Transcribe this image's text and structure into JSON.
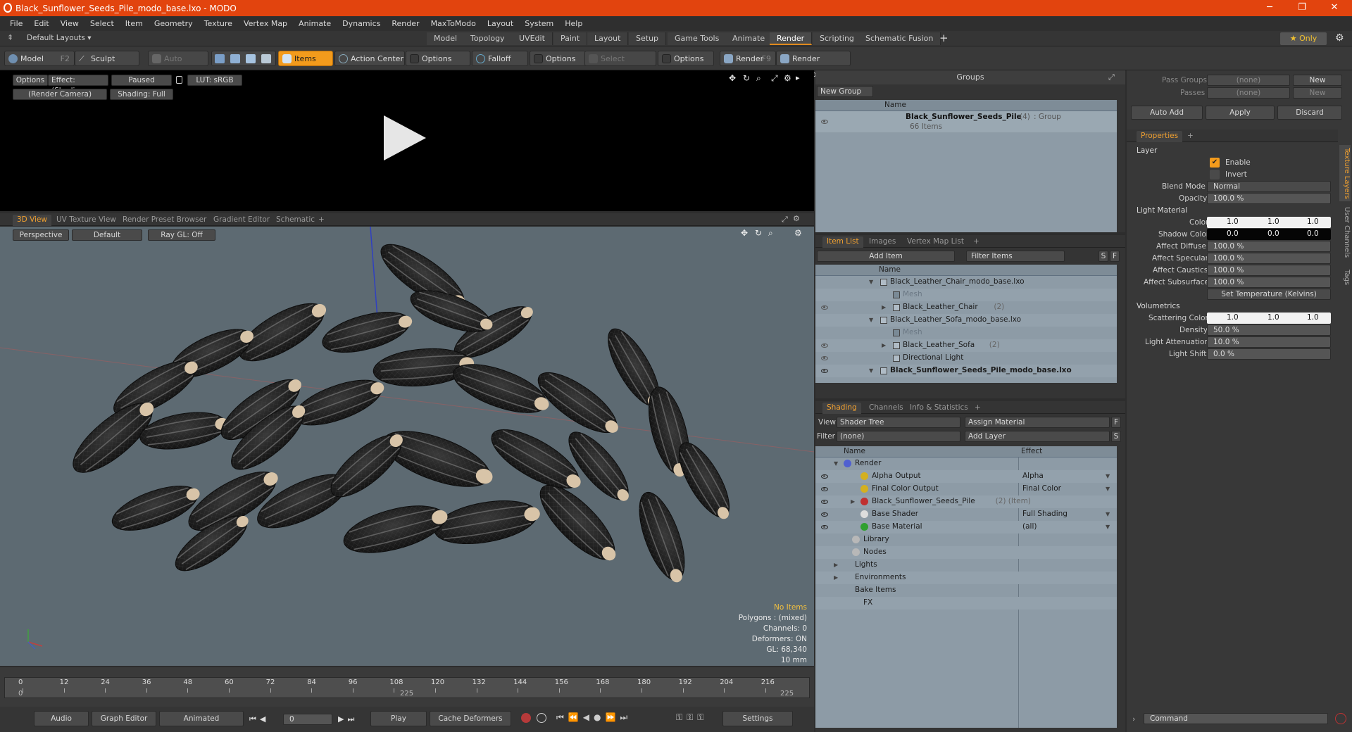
{
  "titlebar": {
    "title": "Black_Sunflower_Seeds_Pile_modo_base.lxo - MODO",
    "min": "─",
    "max": "❐",
    "close": "✕"
  },
  "menu": [
    "File",
    "Edit",
    "View",
    "Select",
    "Item",
    "Geometry",
    "Texture",
    "Vertex Map",
    "Animate",
    "Dynamics",
    "Render",
    "MaxToModo",
    "Layout",
    "System",
    "Help"
  ],
  "layoutbar": {
    "default_layouts": "Default Layouts ▾",
    "tabs": [
      "Model",
      "Topology",
      "UVEdit",
      "Paint",
      "Layout",
      "Setup",
      "Game Tools",
      "Animate",
      "Render",
      "Scripting",
      "Schematic Fusion"
    ],
    "active": "Render",
    "plus": "+",
    "only": "★  Only",
    "gear": "⚙"
  },
  "toolbar": {
    "model": "Model",
    "model_key": "F2",
    "sculpt": "Sculpt",
    "auto_select": "Auto Select",
    "items": "Items",
    "action_center": "Action Center",
    "options1": "Options",
    "falloff": "Falloff",
    "options2": "Options",
    "select_through": "Select Through",
    "options3": "Options",
    "render": "Render",
    "render_key": "F9",
    "render_window": "Render Window"
  },
  "render_view": {
    "options": "Options",
    "effect": "Effect: (Shadi...",
    "paused": "Paused",
    "lut": "LUT: sRGB",
    "camera": "(Render Camera)",
    "shading": "Shading: Full"
  },
  "viewport": {
    "tabs": [
      "3D View",
      "UV Texture View",
      "Render Preset Browser",
      "Gradient Editor",
      "Schematic"
    ],
    "plus": "+",
    "perspective": "Perspective",
    "default": "Default",
    "raygl": "Ray GL: Off",
    "stats": {
      "no_items": "No Items",
      "polygons": "Polygons : (mixed)",
      "channels": "Channels: 0",
      "deformers": "Deformers: ON",
      "gl": "GL: 68,340",
      "scale": "10 mm"
    }
  },
  "timeline": {
    "ticks": [
      "0",
      "12",
      "24",
      "36",
      "48",
      "60",
      "72",
      "84",
      "96",
      "108",
      "120",
      "132",
      "144",
      "156",
      "168",
      "180",
      "192",
      "204",
      "216"
    ],
    "start": "0",
    "mid": "225",
    "end": "225"
  },
  "bottombar": {
    "audio": "Audio",
    "graph_editor": "Graph Editor",
    "animated": "Animated",
    "frame": "0",
    "play": "Play",
    "cache_deformers": "Cache Deformers",
    "settings": "Settings"
  },
  "groups": {
    "title": "Groups",
    "new_group": "New Group",
    "col_name": "Name",
    "group_name": "Black_Sunflower_Seeds_Pile",
    "group_count": "(4)",
    "group_type": ": Group",
    "group_items": "66 Items"
  },
  "itemlist": {
    "tabs": [
      "Item List",
      "Images",
      "Vertex Map List"
    ],
    "plus": "+",
    "add_item": "Add Item",
    "filter_items": "Filter Items",
    "s": "S",
    "f": "F",
    "col_name": "Name",
    "rows": [
      {
        "label": "Black_Leather_Chair_modo_base.lxo",
        "dim": false,
        "count": ""
      },
      {
        "label": "Mesh",
        "dim": true,
        "count": ""
      },
      {
        "label": "Black_Leather_Chair",
        "dim": false,
        "count": "(2)"
      },
      {
        "label": "Black_Leather_Sofa_modo_base.lxo",
        "dim": false,
        "count": ""
      },
      {
        "label": "Mesh",
        "dim": true,
        "count": ""
      },
      {
        "label": "Black_Leather_Sofa",
        "dim": false,
        "count": "(2)"
      },
      {
        "label": "Directional Light",
        "dim": false,
        "count": ""
      },
      {
        "label": "Black_Sunflower_Seeds_Pile_modo_base.lxo",
        "dim": false,
        "count": ""
      }
    ]
  },
  "shading": {
    "tabs": [
      "Shading",
      "Channels",
      "Info & Statistics"
    ],
    "plus": "+",
    "view_label": "View",
    "view_value": "Shader Tree",
    "assign_material": "Assign Material",
    "f": "F",
    "filter_label": "Filter",
    "filter_value": "(none)",
    "add_layer": "Add Layer",
    "s": "S",
    "col_name": "Name",
    "col_effect": "Effect",
    "rows": [
      {
        "label": "Render",
        "effect": "",
        "extra": ""
      },
      {
        "label": "Alpha Output",
        "effect": "Alpha",
        "extra": ""
      },
      {
        "label": "Final Color Output",
        "effect": "Final Color",
        "extra": ""
      },
      {
        "label": "Black_Sunflower_Seeds_Pile",
        "effect": "",
        "extra": "(2) (Item)"
      },
      {
        "label": "Base Shader",
        "effect": "Full Shading",
        "extra": ""
      },
      {
        "label": "Base Material",
        "effect": "(all)",
        "extra": ""
      },
      {
        "label": "Library",
        "effect": "",
        "extra": ""
      },
      {
        "label": "Nodes",
        "effect": "",
        "extra": ""
      },
      {
        "label": "Lights",
        "effect": "",
        "extra": ""
      },
      {
        "label": "Environments",
        "effect": "",
        "extra": ""
      },
      {
        "label": "Bake Items",
        "effect": "",
        "extra": ""
      },
      {
        "label": "FX",
        "effect": "",
        "extra": ""
      }
    ]
  },
  "properties": {
    "pass_groups": "Pass Groups",
    "passes": "Passes",
    "none": "(none)",
    "new": "New",
    "auto_add": "Auto Add",
    "apply": "Apply",
    "discard": "Discard",
    "tab": "Properties",
    "plus": "+",
    "layer_section": "Layer",
    "enable": "Enable",
    "invert": "Invert",
    "blend_mode": "Blend Mode",
    "blend_value": "Normal",
    "opacity": "Opacity",
    "opacity_value": "100.0 %",
    "light_section": "Light Material",
    "color": "Color",
    "color_vals": [
      "1.0",
      "1.0",
      "1.0"
    ],
    "shadow_color": "Shadow Color",
    "shadow_vals": [
      "0.0",
      "0.0",
      "0.0"
    ],
    "affect_diffuse": "Affect Diffuse",
    "affect_specular": "Affect Specular",
    "affect_caustics": "Affect Caustics",
    "affect_subsurface": "Affect Subsurface",
    "pct100": "100.0 %",
    "set_temp": "Set Temperature (Kelvins)",
    "vol_section": "Volumetrics",
    "scattering": "Scattering Color",
    "scatter_vals": [
      "1.0",
      "1.0",
      "1.0"
    ],
    "density": "Density",
    "density_value": "50.0 %",
    "attenuation": "Light Attenuation",
    "attenuation_value": "10.0 %",
    "light_shift": "Light Shift",
    "light_shift_value": "0.0 %",
    "side_tabs": [
      "Texture Layers",
      "User Channels",
      "Tags"
    ],
    "command": "Command"
  }
}
